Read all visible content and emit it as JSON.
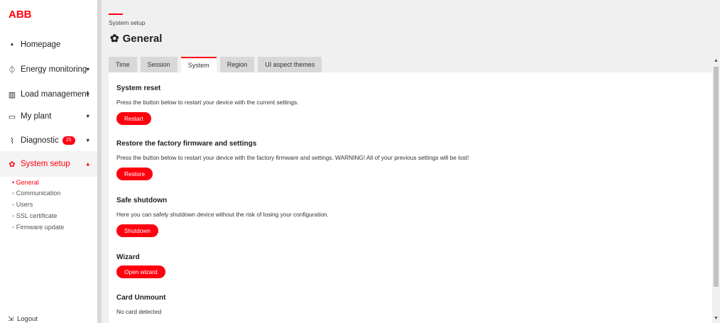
{
  "brand": {
    "logo_text": "ABB",
    "accent": "#ff000f"
  },
  "sidebar": {
    "items": [
      {
        "label": "Homepage",
        "icon": "home-icon"
      },
      {
        "label": "Energy monitoring",
        "icon": "energy-icon"
      },
      {
        "label": "Load management",
        "icon": "chart-icon"
      },
      {
        "label": "My plant",
        "icon": "plant-icon"
      },
      {
        "label": "Diagnostic",
        "icon": "pulse-icon",
        "badge": "25"
      },
      {
        "label": "System setup",
        "icon": "gears-icon"
      }
    ],
    "subitems": [
      "• General",
      "◦ Communication",
      "◦ Users",
      "◦ SSL certificate",
      "◦ Firmware update"
    ],
    "logout_label": "Logout"
  },
  "header": {
    "breadcrumb": "System setup",
    "title": "General"
  },
  "tabs": [
    "Time",
    "Session",
    "System",
    "Region",
    "UI aspect themes"
  ],
  "active_tab": "System",
  "sections": [
    {
      "title": "System reset",
      "desc": "Press the button below to restart your device with the current settings.",
      "button": "Restart"
    },
    {
      "title": "Restore the factory firmware and settings",
      "desc": "Press the button below to restart your device with the factory firmware and settings. WARNING! All of your previous settings will be lost!",
      "button": "Restore"
    },
    {
      "title": "Safe shutdown",
      "desc": "Here you can safely shutdown device without the risk of losing your configuration.",
      "button": "Shutdown"
    },
    {
      "title": "Wizard",
      "button": "Open wizard"
    },
    {
      "title": "Card Unmount",
      "desc": "No card detected"
    }
  ]
}
